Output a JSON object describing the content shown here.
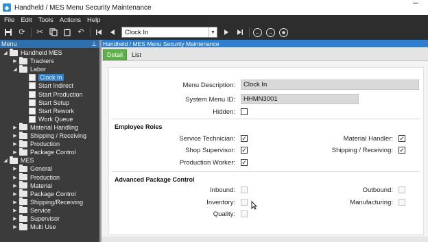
{
  "window": {
    "title": "Handheld / MES Menu Security Maintenance"
  },
  "menubar": [
    "File",
    "Edit",
    "Tools",
    "Actions",
    "Help"
  ],
  "toolbar": {
    "navigator_value": "Clock In"
  },
  "left_panel": {
    "header": "Menu",
    "pin": "⊥",
    "tree": [
      {
        "label": "Handheld MES",
        "level": 0,
        "type": "folder",
        "expanded": true
      },
      {
        "label": "Trackers",
        "level": 1,
        "type": "folder",
        "expanded": false
      },
      {
        "label": "Labor",
        "level": 1,
        "type": "folder",
        "expanded": true
      },
      {
        "label": "Clock In",
        "level": 2,
        "type": "page",
        "selected": true
      },
      {
        "label": "Start Indirect",
        "level": 2,
        "type": "page"
      },
      {
        "label": "Start Production",
        "level": 2,
        "type": "page"
      },
      {
        "label": "Start Setup",
        "level": 2,
        "type": "page"
      },
      {
        "label": "Start Rework",
        "level": 2,
        "type": "page"
      },
      {
        "label": "Work Queue",
        "level": 2,
        "type": "page"
      },
      {
        "label": "Material Handling",
        "level": 1,
        "type": "folder",
        "expanded": false
      },
      {
        "label": "Shipping / Receiving",
        "level": 1,
        "type": "folder",
        "expanded": false
      },
      {
        "label": "Production",
        "level": 1,
        "type": "folder",
        "expanded": false
      },
      {
        "label": "Package Control",
        "level": 1,
        "type": "folder",
        "expanded": false
      },
      {
        "label": "MES",
        "level": 0,
        "type": "folder",
        "expanded": true
      },
      {
        "label": "General",
        "level": 1,
        "type": "folder",
        "expanded": false
      },
      {
        "label": "Production",
        "level": 1,
        "type": "folder",
        "expanded": false
      },
      {
        "label": "Material",
        "level": 1,
        "type": "folder",
        "expanded": false
      },
      {
        "label": "Package Control",
        "level": 1,
        "type": "folder",
        "expanded": false
      },
      {
        "label": "Shipping/Receiving",
        "level": 1,
        "type": "folder",
        "expanded": false
      },
      {
        "label": "Service",
        "level": 1,
        "type": "folder",
        "expanded": false
      },
      {
        "label": "Supervisor",
        "level": 1,
        "type": "folder",
        "expanded": false
      },
      {
        "label": "Multi Use",
        "level": 1,
        "type": "folder",
        "expanded": false
      }
    ]
  },
  "content": {
    "breadcrumb": "Handheld / MES Menu Security Maintenance",
    "tabs": [
      {
        "label": "Detail",
        "active": true
      },
      {
        "label": "List",
        "active": false
      }
    ],
    "form": {
      "menu_description_label": "Menu Description:",
      "menu_description_value": "Clock In",
      "system_menu_id_label": "System Menu ID:",
      "system_menu_id_value": "HHMN3001",
      "hidden_label": "Hidden:",
      "hidden_checked": false
    },
    "employee_roles": {
      "title": "Employee Roles",
      "service_technician": {
        "label": "Service Technician:",
        "checked": true
      },
      "shop_supervisor": {
        "label": "Shop Supervisor:",
        "checked": true
      },
      "production_worker": {
        "label": "Production Worker:",
        "checked": true
      },
      "material_handler": {
        "label": "Material Handler:",
        "checked": true
      },
      "shipping_receiving": {
        "label": "Shipping / Receiving:",
        "checked": true
      }
    },
    "advanced_package_control": {
      "title": "Advanced Package Control",
      "inbound": {
        "label": "Inbound:",
        "checked": false
      },
      "inventory": {
        "label": "Inventory:",
        "checked": false
      },
      "quality": {
        "label": "Quality:",
        "checked": false
      },
      "outbound": {
        "label": "Outbound:",
        "checked": false
      },
      "manufacturing": {
        "label": "Manufacturing:",
        "checked": false
      }
    }
  }
}
